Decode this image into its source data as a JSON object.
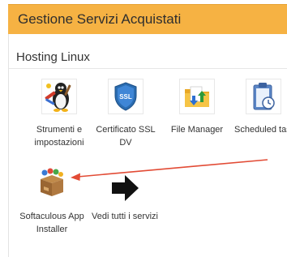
{
  "header": {
    "title": "Gestione Servizi Acquistati",
    "bg_color": "#f6b243"
  },
  "section": {
    "title": "Hosting Linux"
  },
  "services": [
    {
      "label": "Strumenti e impostazioni",
      "icon": "penguin-tools-icon"
    },
    {
      "label": "Certificato SSL DV",
      "icon": "ssl-shield-icon"
    },
    {
      "label": "File Manager",
      "icon": "folder-icon"
    },
    {
      "label": "Scheduled tas",
      "icon": "clipboard-clock-icon"
    },
    {
      "label": "Softaculous App Installer",
      "icon": "softaculous-box-icon"
    },
    {
      "label": "Vedi tutti i servizi",
      "icon": "arrow-right-icon"
    }
  ],
  "annotation": {
    "arrow_color": "#e24b35"
  }
}
